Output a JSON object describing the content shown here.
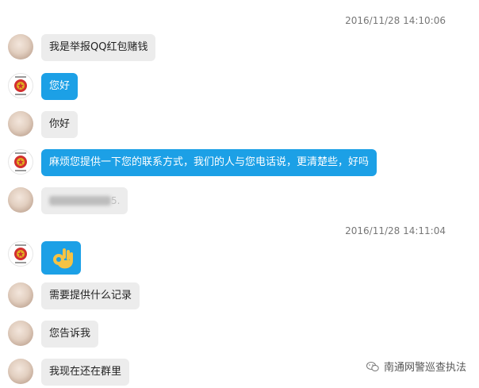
{
  "chat": {
    "timestamps": [
      "2016/11/28 14:10:06",
      "2016/11/28 14:11:04"
    ],
    "messages": [
      {
        "sender": "user",
        "text": "我是举报QQ红包赌钱"
      },
      {
        "sender": "police",
        "text": "您好"
      },
      {
        "sender": "user",
        "text": "你好"
      },
      {
        "sender": "police",
        "text": "麻烦您提供一下您的联系方式，我们的人与您电话说，更清楚些，好吗"
      },
      {
        "sender": "user",
        "text": "",
        "redacted_tail": "5."
      },
      {
        "sender": "police",
        "text": "",
        "emoji": "ok-hand-icon"
      },
      {
        "sender": "user",
        "text": "需要提供什么记录"
      },
      {
        "sender": "user",
        "text": "您告诉我"
      },
      {
        "sender": "user",
        "text": "我现在还在群里"
      }
    ]
  },
  "watermark": {
    "text": "南通网警巡查执法",
    "icon": "wechat-icon"
  },
  "colors": {
    "blue_bubble": "#1ca0e6",
    "gray_bubble": "#ececec",
    "badge_red": "#d32f2f",
    "badge_gold": "#e0b020"
  }
}
